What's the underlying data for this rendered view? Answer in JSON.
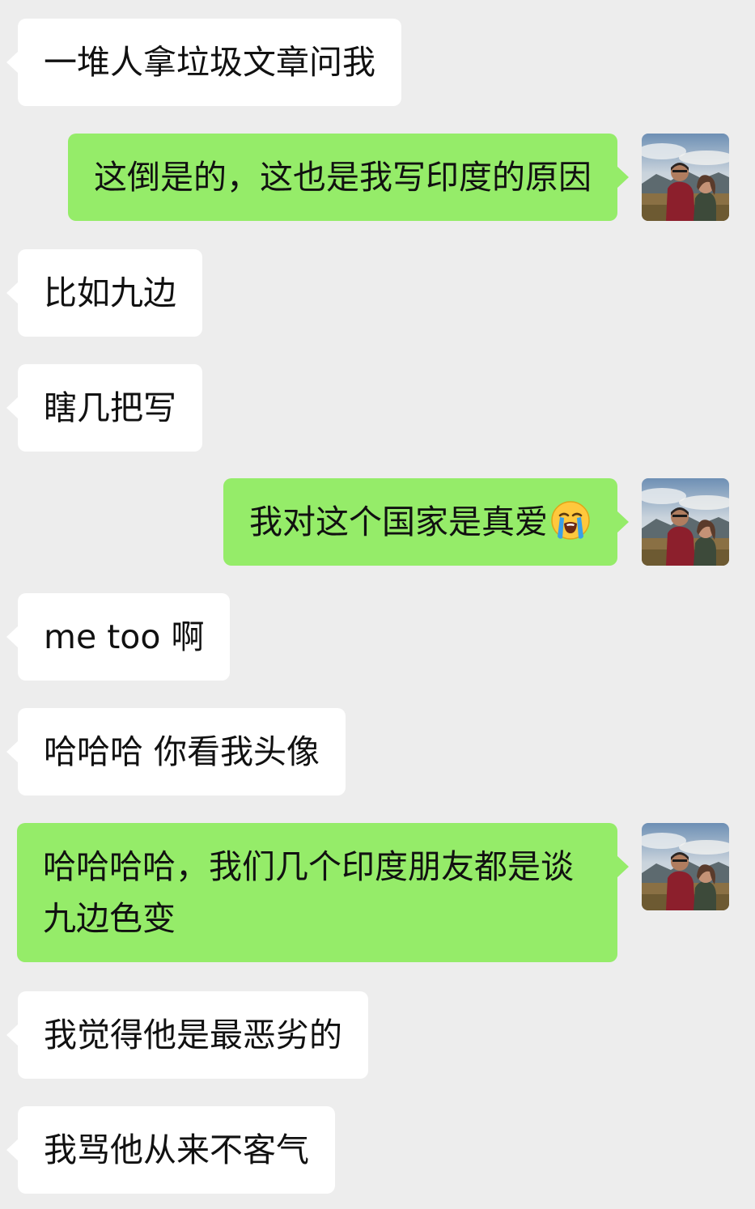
{
  "messages": [
    {
      "side": "in",
      "text": "一堆人拿垃圾文章问我"
    },
    {
      "side": "out",
      "text": "这倒是的，这也是我写印度的原因"
    },
    {
      "side": "in",
      "text": "比如九边"
    },
    {
      "side": "in",
      "text": "瞎几把写"
    },
    {
      "side": "out",
      "text": "我对这个国家是真爱",
      "emoji": "loudly-crying-face"
    },
    {
      "side": "in",
      "text": "me too 啊"
    },
    {
      "side": "in",
      "text": "哈哈哈 你看我头像"
    },
    {
      "side": "out",
      "text": "哈哈哈哈，我们几个印度朋友都是谈九边色变"
    },
    {
      "side": "in",
      "text": "我觉得他是最恶劣的"
    },
    {
      "side": "in",
      "text": "我骂他从来不客气"
    }
  ],
  "colors": {
    "background": "#ededed",
    "incoming_bubble": "#ffffff",
    "outgoing_bubble": "#95ec69",
    "text": "#111111"
  }
}
